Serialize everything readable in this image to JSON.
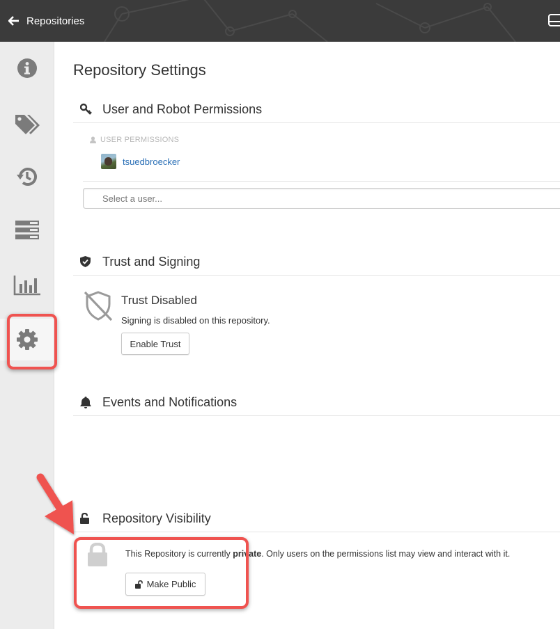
{
  "topbar": {
    "back_label": "Repositories",
    "background": "#3b3b3b"
  },
  "sidebar": {
    "items": [
      {
        "icon": "info-icon"
      },
      {
        "icon": "tags-icon"
      },
      {
        "icon": "history-icon"
      },
      {
        "icon": "builds-icon"
      },
      {
        "icon": "usage-chart-icon"
      },
      {
        "icon": "gear-icon",
        "active": true
      }
    ]
  },
  "page_title": "Repository Settings",
  "permissions": {
    "title": "User and Robot Permissions",
    "section_label": "USER PERMISSIONS",
    "users": [
      {
        "name": "tsuedbroecker"
      }
    ],
    "select_placeholder": "Select a user..."
  },
  "trust": {
    "title": "Trust and Signing",
    "status_title": "Trust Disabled",
    "status_text": "Signing is disabled on this repository.",
    "enable_button": "Enable Trust"
  },
  "events": {
    "title": "Events and Notifications"
  },
  "visibility": {
    "title": "Repository Visibility",
    "text_before": "This Repository is currently ",
    "text_bold": "private",
    "text_after": ". Only users on the permissions list may view and interact with it.",
    "make_public_button": "Make Public"
  },
  "colors": {
    "highlight": "#ef5350",
    "link": "#2a6fb6"
  }
}
